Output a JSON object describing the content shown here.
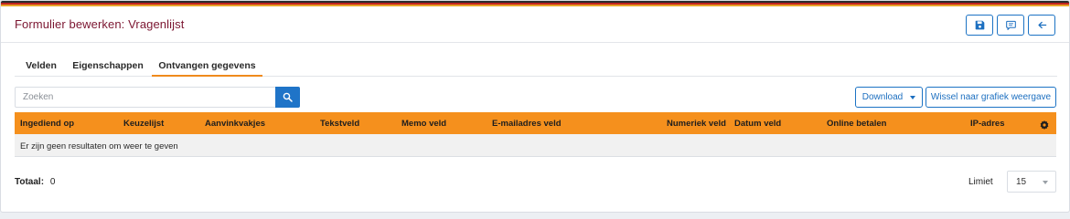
{
  "header": {
    "title": "Formulier bewerken: Vragenlijst",
    "buttons": [
      {
        "icon": "save-icon"
      },
      {
        "icon": "comment-icon"
      },
      {
        "icon": "arrow-left-icon"
      }
    ]
  },
  "tabs": [
    {
      "label": "Velden",
      "active": false
    },
    {
      "label": "Eigenschappen",
      "active": false
    },
    {
      "label": "Ontvangen gegevens",
      "active": true
    }
  ],
  "search": {
    "placeholder": "Zoeken",
    "value": "",
    "icon": "search-icon"
  },
  "actions": {
    "download_label": "Download",
    "toggle_chart_label": "Wissel naar grafiek weergave"
  },
  "table": {
    "columns": [
      "Ingediend op",
      "Keuzelijst",
      "Aanvinkvakjes",
      "Tekstveld",
      "Memo veld",
      "E-mailadres veld",
      "Numeriek veld",
      "Datum veld",
      "Online betalen",
      "IP-adres"
    ],
    "settings_icon": "gear-icon",
    "empty_message": "Er zijn geen resultaten om weer te geven"
  },
  "footer": {
    "total_label": "Totaal:",
    "total_value": "0",
    "limit_label": "Limiet",
    "limit_value": "15"
  },
  "colors": {
    "accent": "#f5901d",
    "primary": "#1f74c8",
    "title": "#7b1530"
  }
}
